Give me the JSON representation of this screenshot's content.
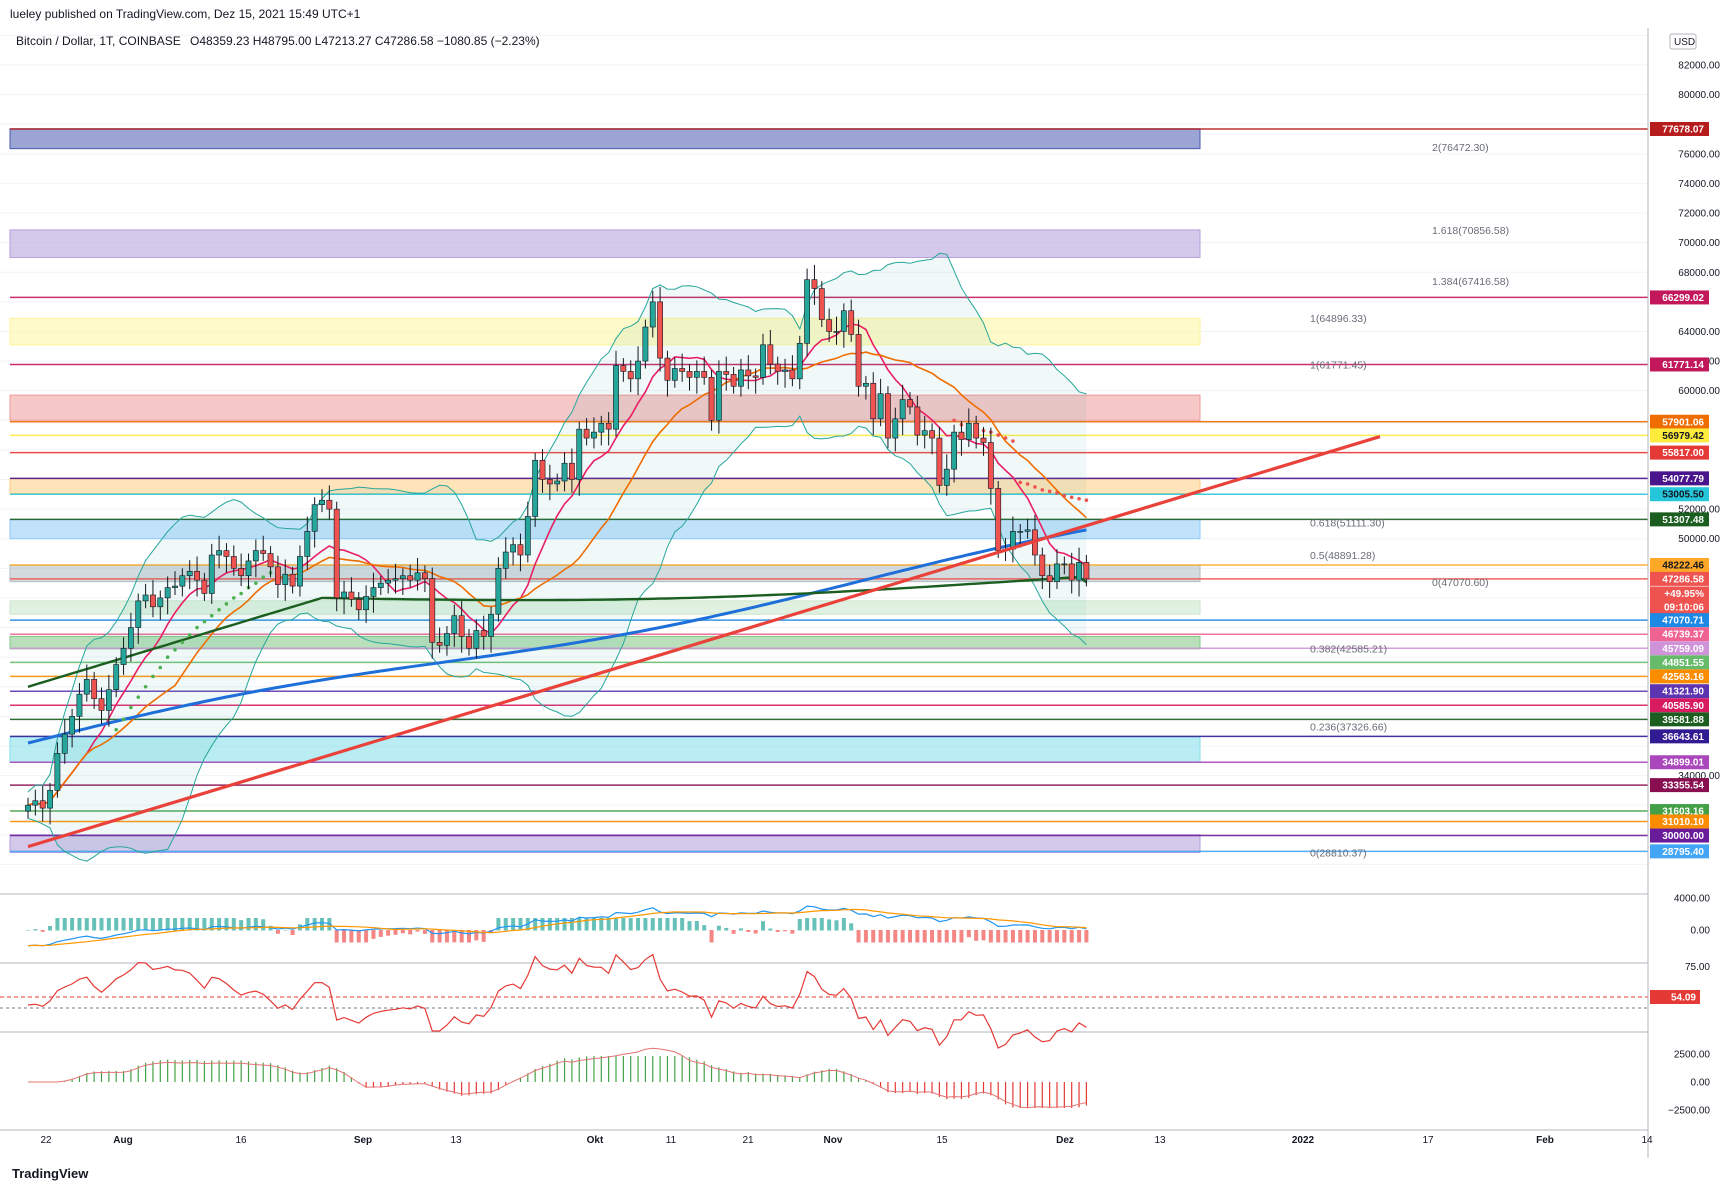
{
  "header": {
    "published": "lueley published on TradingView.com, Dez 15, 2021 15:49 UTC+1"
  },
  "legend": {
    "symbol": "Bitcoin / Dollar, 1T, COINBASE",
    "ohlc": "O48359.23 H48795.00 L47213.27 C47286.58 −1080.85 (−2.23%)"
  },
  "currency_button": "USD",
  "footer": {
    "brand": "TradingView"
  },
  "colors": {
    "up_candle": "#26a69a",
    "down_candle": "#ef5350",
    "trendline": "#e8423a",
    "ema_blue": "#1e6fd9",
    "ema_green": "#1b5e20"
  },
  "chart_data": {
    "type": "candlestick",
    "title": "Bitcoin / Dollar, 1T, COINBASE",
    "ylim": [
      26000,
      84500
    ],
    "x_tick_labels": [
      "22",
      "Aug",
      "16",
      "Sep",
      "13",
      "Okt",
      "11",
      "21",
      "Nov",
      "15",
      "Dez",
      "13",
      "2022",
      "17",
      "Feb",
      "14"
    ],
    "y_tick_labels": [
      "82000.00",
      "80000.00",
      "76000.00",
      "74000.00",
      "72000.00",
      "70000.00",
      "68000.00",
      "64000.00",
      "62000.00",
      "60000.00",
      "52000.00",
      "50000.00",
      "34000.00"
    ],
    "close_prices": [
      32000,
      32300,
      31800,
      33000,
      35500,
      36800,
      38000,
      39500,
      40500,
      39200,
      38400,
      39800,
      41500,
      42600,
      44000,
      45800,
      46200,
      45400,
      46000,
      46700,
      46800,
      47500,
      47800,
      47200,
      46300,
      48900,
      49200,
      48800,
      48000,
      47500,
      48500,
      49200,
      49000,
      48100,
      46900,
      47600,
      46800,
      48800,
      50500,
      52300,
      52600,
      52000,
      46000,
      46400,
      45900,
      45200,
      46100,
      46700,
      47000,
      47200,
      47300,
      47500,
      47200,
      47700,
      47300,
      43000,
      42800,
      43600,
      44800,
      43400,
      42600,
      43800,
      43400,
      44900,
      48000,
      49100,
      49600,
      48900,
      51500,
      55300,
      54000,
      53700,
      53900,
      55100,
      54000,
      57400,
      56800,
      57200,
      57800,
      57400,
      61700,
      61300,
      60800,
      62000,
      64300,
      66000,
      62200,
      60700,
      61500,
      61300,
      60900,
      61300,
      60900,
      58000,
      61300,
      61100,
      60300,
      61400,
      61000,
      60900,
      63100,
      61800,
      61300,
      61400,
      60800,
      63200,
      67500,
      66900,
      64800,
      64000,
      64000,
      65400,
      63800,
      60300,
      60500,
      58100,
      59800,
      56800,
      58100,
      59400,
      58900,
      57000,
      57300,
      56800,
      53600,
      54700,
      57200,
      56700,
      57800,
      56800,
      56500,
      53400,
      49200,
      49300,
      50500,
      50500,
      50600,
      48900,
      47500,
      47100,
      48300,
      48300,
      47200,
      48400,
      47286.58
    ],
    "indicators": {
      "ema_blue_last": 50100,
      "ema_green_last": 47070.6,
      "parabolic_sar_up": [
        37100,
        37800,
        38600,
        39300,
        40000,
        40700,
        41300,
        42000,
        42500,
        43000,
        43500,
        44000,
        44400,
        44800,
        45200,
        45600,
        46000,
        46300,
        46700,
        47000,
        47400,
        47700
      ],
      "parabolic_sar_down": [
        53500,
        53200,
        53000,
        52900,
        52800,
        52700,
        52500,
        52300,
        52100,
        49300,
        49200,
        49000,
        48800,
        48700,
        48600,
        48400,
        48300,
        48200,
        48100
      ]
    },
    "fibonacci": [
      {
        "label": "2(76472.30)",
        "value": 76472.3
      },
      {
        "label": "1.618(70856.58)",
        "value": 70856.58
      },
      {
        "label": "1.384(67416.58)",
        "value": 67416.58
      },
      {
        "label": "1(64896.33)",
        "value": 64896.33
      },
      {
        "label": "1(61771.45)",
        "value": 61771.45
      },
      {
        "label": "0.618(51111.30)",
        "value": 51111.3
      },
      {
        "label": "0.5(48891.28)",
        "value": 48891.28
      },
      {
        "label": "0(47070.60)",
        "value": 47070.6
      },
      {
        "label": "0.382(42585.21)",
        "value": 42585.21
      },
      {
        "label": "0.236(37326.66)",
        "value": 37326.66
      },
      {
        "label": "0(28810.37)",
        "value": 28810.37
      }
    ],
    "zones": [
      {
        "from": 76350,
        "to": 77690,
        "color": "#4a5ab0"
      },
      {
        "from": 69000,
        "to": 70860,
        "color": "#b39ddb"
      },
      {
        "from": 63100,
        "to": 64890,
        "color": "#fff59d"
      },
      {
        "from": 58000,
        "to": 59700,
        "color": "#ef9a9a"
      },
      {
        "from": 53050,
        "to": 54050,
        "color": "#ffcc80"
      },
      {
        "from": 50000,
        "to": 51300,
        "color": "#90caf9"
      },
      {
        "from": 47100,
        "to": 48220,
        "color": "#b0bec5"
      },
      {
        "from": 44900,
        "to": 45800,
        "color": "#c8e6c9"
      },
      {
        "from": 42560,
        "to": 43400,
        "color": "#81c784"
      },
      {
        "from": 34900,
        "to": 36600,
        "color": "#80deea"
      },
      {
        "from": 28800,
        "to": 30000,
        "color": "#b39ddb"
      }
    ],
    "price_labels": [
      {
        "text": "77678.07",
        "value": 77678.07,
        "bg": "#b71c1c",
        "fg": "#ffffff"
      },
      {
        "text": "66299.02",
        "value": 66299.02,
        "bg": "#c2185b",
        "fg": "#ffffff"
      },
      {
        "text": "61771.14",
        "value": 61771.14,
        "bg": "#c2185b",
        "fg": "#ffffff"
      },
      {
        "text": "57901.06",
        "value": 57901.06,
        "bg": "#ef6c00",
        "fg": "#ffffff"
      },
      {
        "text": "56979.42",
        "value": 56979.42,
        "bg": "#ffeb3b",
        "fg": "#131722"
      },
      {
        "text": "55817.00",
        "value": 55817.0,
        "bg": "#e53935",
        "fg": "#ffffff"
      },
      {
        "text": "54077.79",
        "value": 54077.79,
        "bg": "#4a148c",
        "fg": "#ffffff"
      },
      {
        "text": "53005.50",
        "value": 53005.5,
        "bg": "#26c6da",
        "fg": "#131722"
      },
      {
        "text": "51307.48",
        "value": 51307.48,
        "bg": "#1b5e20",
        "fg": "#ffffff"
      },
      {
        "text": "48222.46",
        "value": 48222.46,
        "bg": "#ffa726",
        "fg": "#131722"
      },
      {
        "text": "47286.58",
        "value": 47286.58,
        "bg": "#ef5350",
        "fg": "#ffffff"
      },
      {
        "text": "+49.95%",
        "value": 46300,
        "bg": "#ef5350",
        "fg": "#ffffff"
      },
      {
        "text": "09:10:06",
        "value": 45400,
        "bg": "#ef5350",
        "fg": "#ffffff"
      },
      {
        "text": "47070.71",
        "value": 44500,
        "bg": "#1e88e5",
        "fg": "#ffffff"
      },
      {
        "text": "46739.37",
        "value": 43550,
        "bg": "#f06292",
        "fg": "#ffffff"
      },
      {
        "text": "45759.09",
        "value": 42600,
        "bg": "#ce93d8",
        "fg": "#ffffff"
      },
      {
        "text": "44851.55",
        "value": 41650,
        "bg": "#66bb6a",
        "fg": "#ffffff"
      },
      {
        "text": "42563.16",
        "value": 40700,
        "bg": "#fb8c00",
        "fg": "#ffffff"
      },
      {
        "text": "41321.90",
        "value": 39700,
        "bg": "#5e35b1",
        "fg": "#ffffff"
      },
      {
        "text": "40585.90",
        "value": 38750,
        "bg": "#d81b60",
        "fg": "#ffffff"
      },
      {
        "text": "39581.88",
        "value": 37800,
        "bg": "#1b5e20",
        "fg": "#ffffff"
      },
      {
        "text": "36643.61",
        "value": 36650,
        "bg": "#311b92",
        "fg": "#ffffff"
      },
      {
        "text": "34899.01",
        "value": 34900,
        "bg": "#ab47bc",
        "fg": "#ffffff"
      },
      {
        "text": "33355.54",
        "value": 33355.54,
        "bg": "#880e4f",
        "fg": "#ffffff"
      },
      {
        "text": "31603.16",
        "value": 31603.16,
        "bg": "#43a047",
        "fg": "#ffffff"
      },
      {
        "text": "31010.10",
        "value": 30900,
        "bg": "#fb8c00",
        "fg": "#ffffff"
      },
      {
        "text": "30000.00",
        "value": 29950,
        "bg": "#6a1b9a",
        "fg": "#ffffff"
      },
      {
        "text": "28795.40",
        "value": 28880,
        "bg": "#42a5f5",
        "fg": "#ffffff"
      }
    ],
    "macd_panel": {
      "labels": [
        "4000.00",
        "0.00"
      ]
    },
    "rsi_panel": {
      "labels": [
        "75.00",
        "54.09"
      ],
      "last": 54.09
    },
    "ao_panel": {
      "labels": [
        "2500.00",
        "0.00",
        "−2500.00"
      ]
    }
  }
}
